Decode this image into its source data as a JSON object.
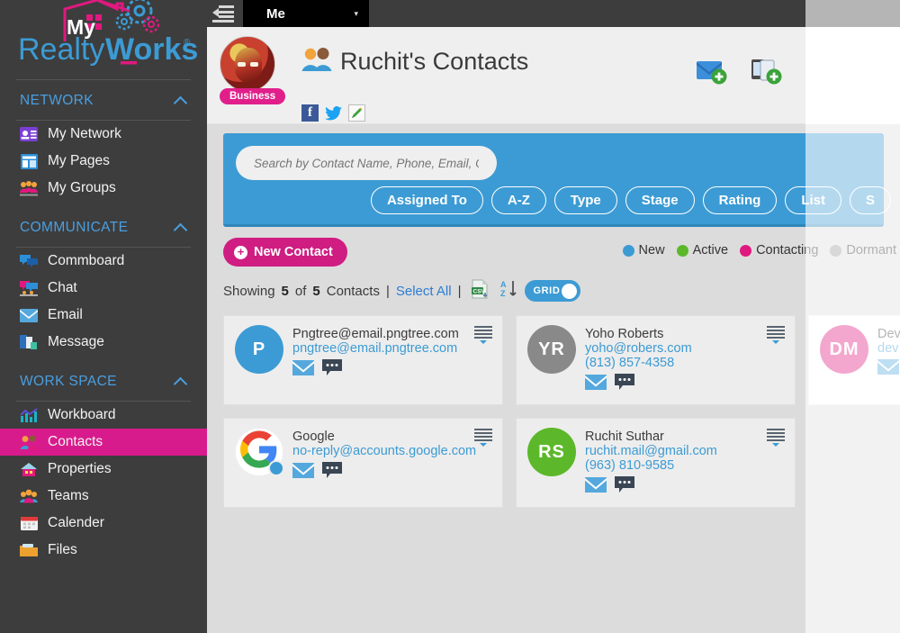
{
  "topbar": {
    "collapse_icon": "collapse-sidebar-icon",
    "scope_dropdown": {
      "value": "Me",
      "caret": "▾"
    }
  },
  "sidebar": {
    "logo": {
      "line1": "My",
      "line2a": "Realty",
      "line2b": "Works",
      "trademark": "®"
    },
    "sections": [
      {
        "title": "NETWORK",
        "items": [
          {
            "label": "My Network",
            "icon": "id-card-icon"
          },
          {
            "label": "My Pages",
            "icon": "pages-layout-icon"
          },
          {
            "label": "My Groups",
            "icon": "groups-icon"
          }
        ]
      },
      {
        "title": "COMMUNICATE",
        "items": [
          {
            "label": "Commboard",
            "icon": "comment-board-icon"
          },
          {
            "label": "Chat",
            "icon": "chat-icon"
          },
          {
            "label": "Email",
            "icon": "envelope-icon"
          },
          {
            "label": "Message",
            "icon": "message-icon"
          }
        ]
      },
      {
        "title": "WORK SPACE",
        "items": [
          {
            "label": "Workboard",
            "icon": "bar-chart-icon",
            "active": false
          },
          {
            "label": "Contacts",
            "icon": "contacts-icon",
            "active": true
          },
          {
            "label": "Properties",
            "icon": "house-icon",
            "active": false
          },
          {
            "label": "Teams",
            "icon": "teams-icon",
            "active": false
          },
          {
            "label": "Calender",
            "icon": "calendar-icon",
            "active": false
          },
          {
            "label": "Files",
            "icon": "folder-icon",
            "active": false
          }
        ]
      }
    ]
  },
  "page_header": {
    "title": "Ruchit's Contacts",
    "title_icon": "two-people-icon",
    "avatar_badge": "Business",
    "avatar": "user-avatar",
    "social": [
      {
        "name": "facebook-icon",
        "glyph": "f"
      },
      {
        "name": "twitter-icon",
        "glyph": "🐦"
      },
      {
        "name": "edit-pencil-icon",
        "glyph": "✎"
      }
    ],
    "tools": [
      {
        "name": "new-email-icon"
      },
      {
        "name": "new-mobile-contact-icon"
      },
      {
        "name": "new-chat-contact-icon"
      },
      {
        "name": "import-contacts-icon"
      }
    ]
  },
  "filter_bar": {
    "search_placeholder": "Search by Contact Name, Phone, Email, Company...",
    "search_value": "",
    "chips": [
      "Assigned To",
      "A-Z",
      "Type",
      "Stage",
      "Rating",
      "List",
      "S"
    ]
  },
  "actions": {
    "new_contact_label": "New Contact",
    "new_contact_plus": "+",
    "legend": [
      {
        "label": "New",
        "color": "#3c9bd4"
      },
      {
        "label": "Active",
        "color": "#5cb82a"
      },
      {
        "label": "Contacting",
        "color": "#e0197f"
      },
      {
        "label": "Dormant",
        "color": "#9a9a9a"
      }
    ]
  },
  "showing": {
    "prefix": "Showing",
    "count": "5",
    "of": "of",
    "total": "5",
    "suffix": "Contacts",
    "sep1": "|",
    "select_all": "Select All",
    "sep2": "|",
    "csv_icon": "csv-export-icon",
    "sort_icon": "sort-az-icon",
    "grid_label": "GRID"
  },
  "contacts": [
    {
      "initials": "P",
      "avatar_color": "#3c9bd4",
      "name": "Pngtree@email.pngtree.com",
      "email": "pngtree@email.pngtree.com",
      "phone": "",
      "status_color": "",
      "logo": ""
    },
    {
      "initials": "YR",
      "avatar_color": "#898989",
      "name": "Yoho Roberts",
      "email": "yoho@robers.com",
      "phone": "(813) 857-4358",
      "status_color": "",
      "logo": ""
    },
    {
      "initials": "DM",
      "avatar_color": "#e0197f",
      "name": "Dev",
      "email": "dev",
      "phone": "",
      "status_color": "",
      "logo": ""
    },
    {
      "initials": "",
      "avatar_color": "#ffffff",
      "name": "Google",
      "email": "no-reply@accounts.google.com",
      "phone": "",
      "status_color": "#3c9bd4",
      "logo": "google-logo"
    },
    {
      "initials": "RS",
      "avatar_color": "#5cb82a",
      "name": "Ruchit Suthar",
      "email": "ruchit.mail@gmail.com",
      "phone": "(963) 810-9585",
      "status_color": "",
      "logo": ""
    }
  ],
  "colors": {
    "sidebar_bg": "#3d3d3d",
    "accent_pink": "#d81b8c",
    "accent_blue": "#3c9bd4",
    "content_bg": "#dcdcdc"
  }
}
